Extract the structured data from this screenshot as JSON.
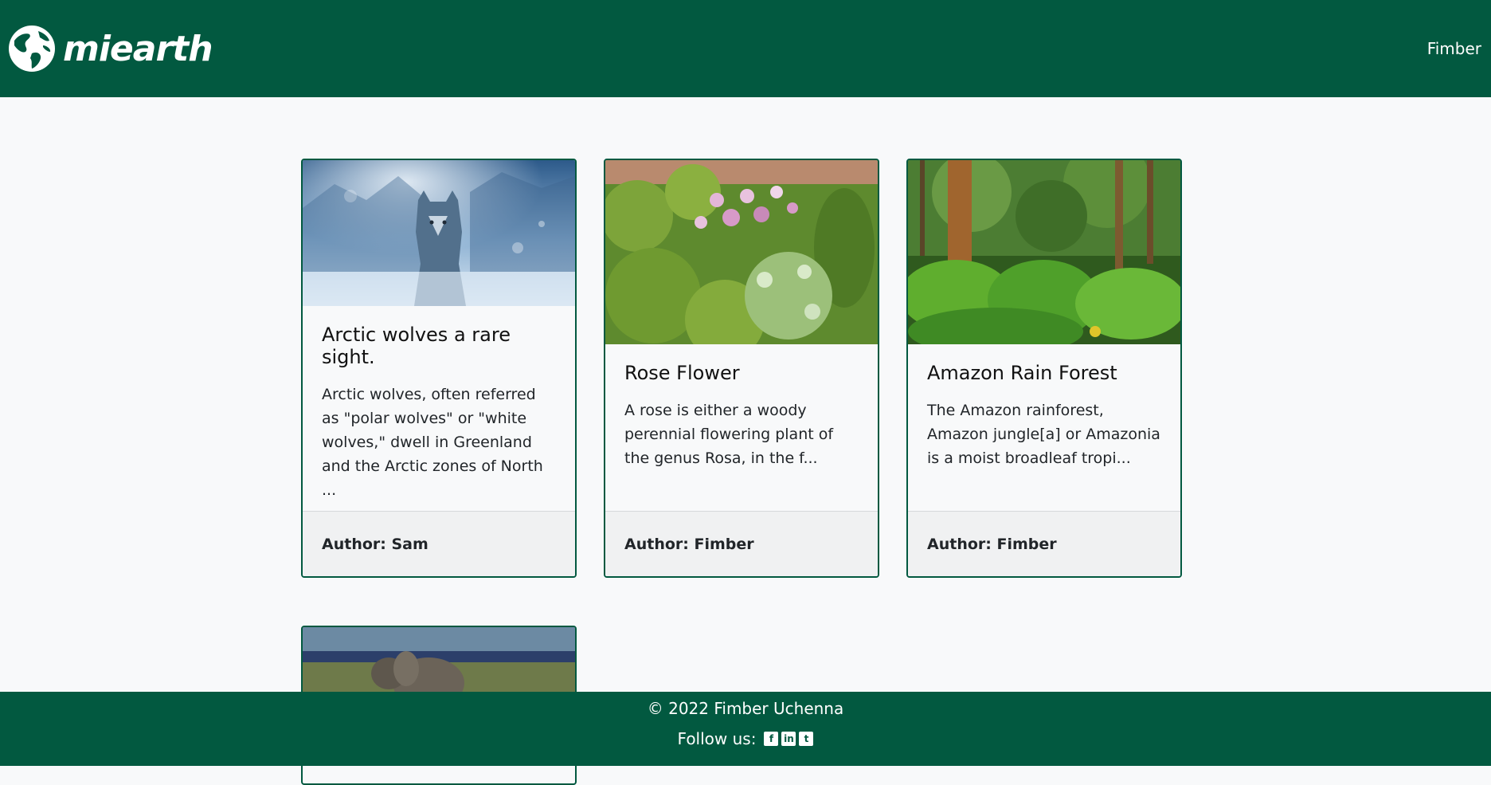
{
  "navbar": {
    "brand_name": "miearth",
    "brand_icon": "globe-icon",
    "user_label": "Fimber"
  },
  "cards": [
    {
      "title": "Arctic wolves a rare sight.",
      "text": "Arctic wolves, often referred as \"polar wolves\" or \"white wolves,\" dwell in Greenland and the Arctic zones of North ...",
      "author": "Author: Sam",
      "image": "arctic-wolf-photo"
    },
    {
      "title": "Rose Flower",
      "text": "A rose is either a woody perennial flowering plant of the genus Rosa, in the f...",
      "author": "Author: Fimber",
      "image": "flower-garden-photo"
    },
    {
      "title": "Amazon Rain Forest",
      "text": "The Amazon rainforest, Amazon jungle[a] or Amazonia is a moist broadleaf tropi...",
      "author": "Author: Fimber",
      "image": "rainforest-photo"
    },
    {
      "image": "elephant-photo"
    }
  ],
  "footer": {
    "copyright": "© 2022 Fimber Uchenna",
    "follow_label": "Follow us:",
    "social_icons": [
      "facebook-icon",
      "linkedin-icon",
      "twitter-icon"
    ]
  },
  "colors": {
    "brand_green": "#025940",
    "page_background": "#f8f9fa",
    "card_footer": "#f0f1f2"
  }
}
